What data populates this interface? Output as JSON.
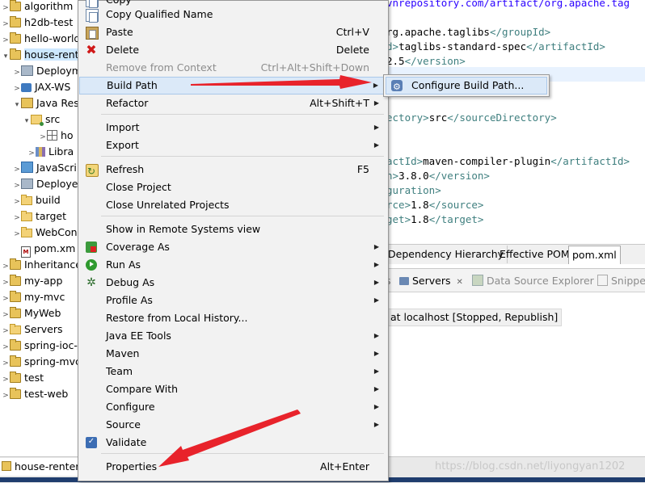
{
  "explorer": {
    "items": [
      {
        "label": "algorithm",
        "twisty": ">",
        "icon": "project-icon"
      },
      {
        "label": "h2db-test",
        "twisty": ">",
        "icon": "project-icon"
      },
      {
        "label": "hello-world",
        "twisty": ">",
        "icon": "project-icon"
      },
      {
        "label": "house-renter",
        "twisty": "▾",
        "icon": "project-icon"
      },
      {
        "label": "Deployment",
        "twisty": ">",
        "icon": "deployment-icon"
      },
      {
        "label": "JAX-WS",
        "twisty": ">",
        "icon": "jaxws-icon"
      },
      {
        "label": "Java Res",
        "twisty": "▾",
        "icon": "java-resources-icon"
      },
      {
        "label": "src",
        "twisty": "▾",
        "icon": "source-folder-icon"
      },
      {
        "label": "ho",
        "twisty": ">",
        "icon": "package-icon"
      },
      {
        "label": "Libra",
        "twisty": ">",
        "icon": "library-icon"
      },
      {
        "label": "JavaScri",
        "twisty": ">",
        "icon": "javascript-icon"
      },
      {
        "label": "Deploye",
        "twisty": ">",
        "icon": "deployed-icon"
      },
      {
        "label": "build",
        "twisty": ">",
        "icon": "folder-icon"
      },
      {
        "label": "target",
        "twisty": ">",
        "icon": "folder-icon"
      },
      {
        "label": "WebCon",
        "twisty": ">",
        "icon": "folder-icon"
      },
      {
        "label": "pom.xm",
        "twisty": "",
        "icon": "xml-file-icon"
      },
      {
        "label": "Inheritance",
        "twisty": ">",
        "icon": "project-icon"
      },
      {
        "label": "my-app",
        "twisty": ">",
        "icon": "project-icon"
      },
      {
        "label": "my-mvc",
        "twisty": ">",
        "icon": "project-icon"
      },
      {
        "label": "MyWeb",
        "twisty": ">",
        "icon": "project-icon"
      },
      {
        "label": "Servers",
        "twisty": ">",
        "icon": "folder-icon"
      },
      {
        "label": "spring-ioc-",
        "twisty": ">",
        "icon": "project-icon"
      },
      {
        "label": "spring-mvc",
        "twisty": ">",
        "icon": "project-icon"
      },
      {
        "label": "test",
        "twisty": ">",
        "icon": "project-icon"
      },
      {
        "label": "test-web",
        "twisty": ">",
        "icon": "project-icon"
      }
    ]
  },
  "editor": {
    "lines": [
      {
        "parts": [
          {
            "t": "vnrepository.com/artifact/org.apache.tag",
            "c": "url"
          }
        ]
      },
      {
        "parts": [
          {
            "t": "rg.apache.taglibs",
            "c": "txt"
          },
          {
            "t": "</groupId>",
            "c": "tag"
          }
        ]
      },
      {
        "parts": [
          {
            "t": "d>",
            "c": "tag"
          },
          {
            "t": "taglibs-standard-spec",
            "c": "txt"
          },
          {
            "t": "</artifactId>",
            "c": "tag"
          }
        ]
      },
      {
        "parts": [
          {
            "t": "2.5",
            "c": "txt"
          },
          {
            "t": "</version>",
            "c": "tag"
          }
        ]
      },
      {
        "parts": []
      },
      {
        "parts": []
      },
      {
        "parts": []
      },
      {
        "parts": []
      },
      {
        "parts": [
          {
            "t": "ectory>",
            "c": "tag"
          },
          {
            "t": "src",
            "c": "txt"
          },
          {
            "t": "</sourceDirectory>",
            "c": "tag"
          }
        ]
      },
      {
        "parts": []
      },
      {
        "parts": []
      },
      {
        "parts": [
          {
            "t": "actId>",
            "c": "tag"
          },
          {
            "t": "maven-compiler-plugin",
            "c": "txt"
          },
          {
            "t": "</artifactId>",
            "c": "tag"
          }
        ]
      },
      {
        "parts": [
          {
            "t": "n>",
            "c": "tag"
          },
          {
            "t": "3.8.0",
            "c": "txt"
          },
          {
            "t": "</version>",
            "c": "tag"
          }
        ]
      },
      {
        "parts": [
          {
            "t": "guration>",
            "c": "tag"
          }
        ]
      },
      {
        "parts": [
          {
            "t": "rce>",
            "c": "tag"
          },
          {
            "t": "1.8",
            "c": "txt"
          },
          {
            "t": "</source>",
            "c": "tag"
          }
        ]
      },
      {
        "parts": [
          {
            "t": "get>",
            "c": "tag"
          },
          {
            "t": "1.8",
            "c": "txt"
          },
          {
            "t": "</target>",
            "c": "tag"
          }
        ]
      }
    ],
    "tabs": [
      "Dependency Hierarchy",
      "Effective POM",
      "pom.xml"
    ],
    "active_tab": "pom.xml"
  },
  "lower_view": {
    "tabs": [
      {
        "label": "Servers",
        "close": "✕",
        "dim": false
      },
      {
        "label": "Data Source Explorer",
        "close": "",
        "dim": true
      },
      {
        "label": "Snippe",
        "close": "",
        "dim": true
      }
    ],
    "server_row": "at localhost  [Stopped, Republish]"
  },
  "bottom": {
    "selected_label": "house-renter"
  },
  "watermark": "https://blog.csdn.net/liyongyan1202",
  "context_menu": {
    "items": [
      {
        "label": "Copy",
        "accel": "",
        "icon": "copy",
        "submenu": false,
        "disabled": false
      },
      {
        "label": "Copy Qualified Name",
        "accel": "",
        "icon": "copy",
        "submenu": false,
        "disabled": false
      },
      {
        "label": "Paste",
        "accel": "Ctrl+V",
        "icon": "paste",
        "submenu": false,
        "disabled": false
      },
      {
        "label": "Delete",
        "accel": "Delete",
        "icon": "delete",
        "submenu": false,
        "disabled": false
      },
      {
        "label": "Remove from Context",
        "accel": "Ctrl+Alt+Shift+Down",
        "icon": "",
        "submenu": false,
        "disabled": true
      },
      {
        "label": "Build Path",
        "accel": "",
        "icon": "",
        "submenu": true,
        "disabled": false,
        "hover": true
      },
      {
        "label": "Refactor",
        "accel": "Alt+Shift+T",
        "icon": "",
        "submenu": true,
        "disabled": false
      },
      {
        "sep": true
      },
      {
        "label": "Import",
        "accel": "",
        "icon": "",
        "submenu": true,
        "disabled": false
      },
      {
        "label": "Export",
        "accel": "",
        "icon": "",
        "submenu": true,
        "disabled": false
      },
      {
        "sep": true
      },
      {
        "label": "Refresh",
        "accel": "F5",
        "icon": "refresh",
        "submenu": false,
        "disabled": false
      },
      {
        "label": "Close Project",
        "accel": "",
        "icon": "",
        "submenu": false,
        "disabled": false
      },
      {
        "label": "Close Unrelated Projects",
        "accel": "",
        "icon": "",
        "submenu": false,
        "disabled": false
      },
      {
        "sep": true
      },
      {
        "label": "Show in Remote Systems view",
        "accel": "",
        "icon": "",
        "submenu": false,
        "disabled": false
      },
      {
        "label": "Coverage As",
        "accel": "",
        "icon": "coverage",
        "submenu": true,
        "disabled": false
      },
      {
        "label": "Run As",
        "accel": "",
        "icon": "run",
        "submenu": true,
        "disabled": false
      },
      {
        "label": "Debug As",
        "accel": "",
        "icon": "debug",
        "submenu": true,
        "disabled": false
      },
      {
        "label": "Profile As",
        "accel": "",
        "icon": "",
        "submenu": true,
        "disabled": false
      },
      {
        "label": "Restore from Local History...",
        "accel": "",
        "icon": "",
        "submenu": false,
        "disabled": false
      },
      {
        "label": "Java EE Tools",
        "accel": "",
        "icon": "",
        "submenu": true,
        "disabled": false
      },
      {
        "label": "Maven",
        "accel": "",
        "icon": "",
        "submenu": true,
        "disabled": false
      },
      {
        "label": "Team",
        "accel": "",
        "icon": "",
        "submenu": true,
        "disabled": false
      },
      {
        "label": "Compare With",
        "accel": "",
        "icon": "",
        "submenu": true,
        "disabled": false
      },
      {
        "label": "Configure",
        "accel": "",
        "icon": "",
        "submenu": true,
        "disabled": false
      },
      {
        "label": "Source",
        "accel": "",
        "icon": "",
        "submenu": true,
        "disabled": false
      },
      {
        "label": "Validate",
        "accel": "",
        "icon": "check",
        "submenu": false,
        "disabled": false
      },
      {
        "sep": true
      },
      {
        "label": "Properties",
        "accel": "Alt+Enter",
        "icon": "",
        "submenu": false,
        "disabled": false
      }
    ]
  },
  "submenu": {
    "label": "Configure Build Path..."
  },
  "colors": {
    "arrow": "#e8232b",
    "hover": "#dbe9f8",
    "selection": "#cde8ff"
  }
}
